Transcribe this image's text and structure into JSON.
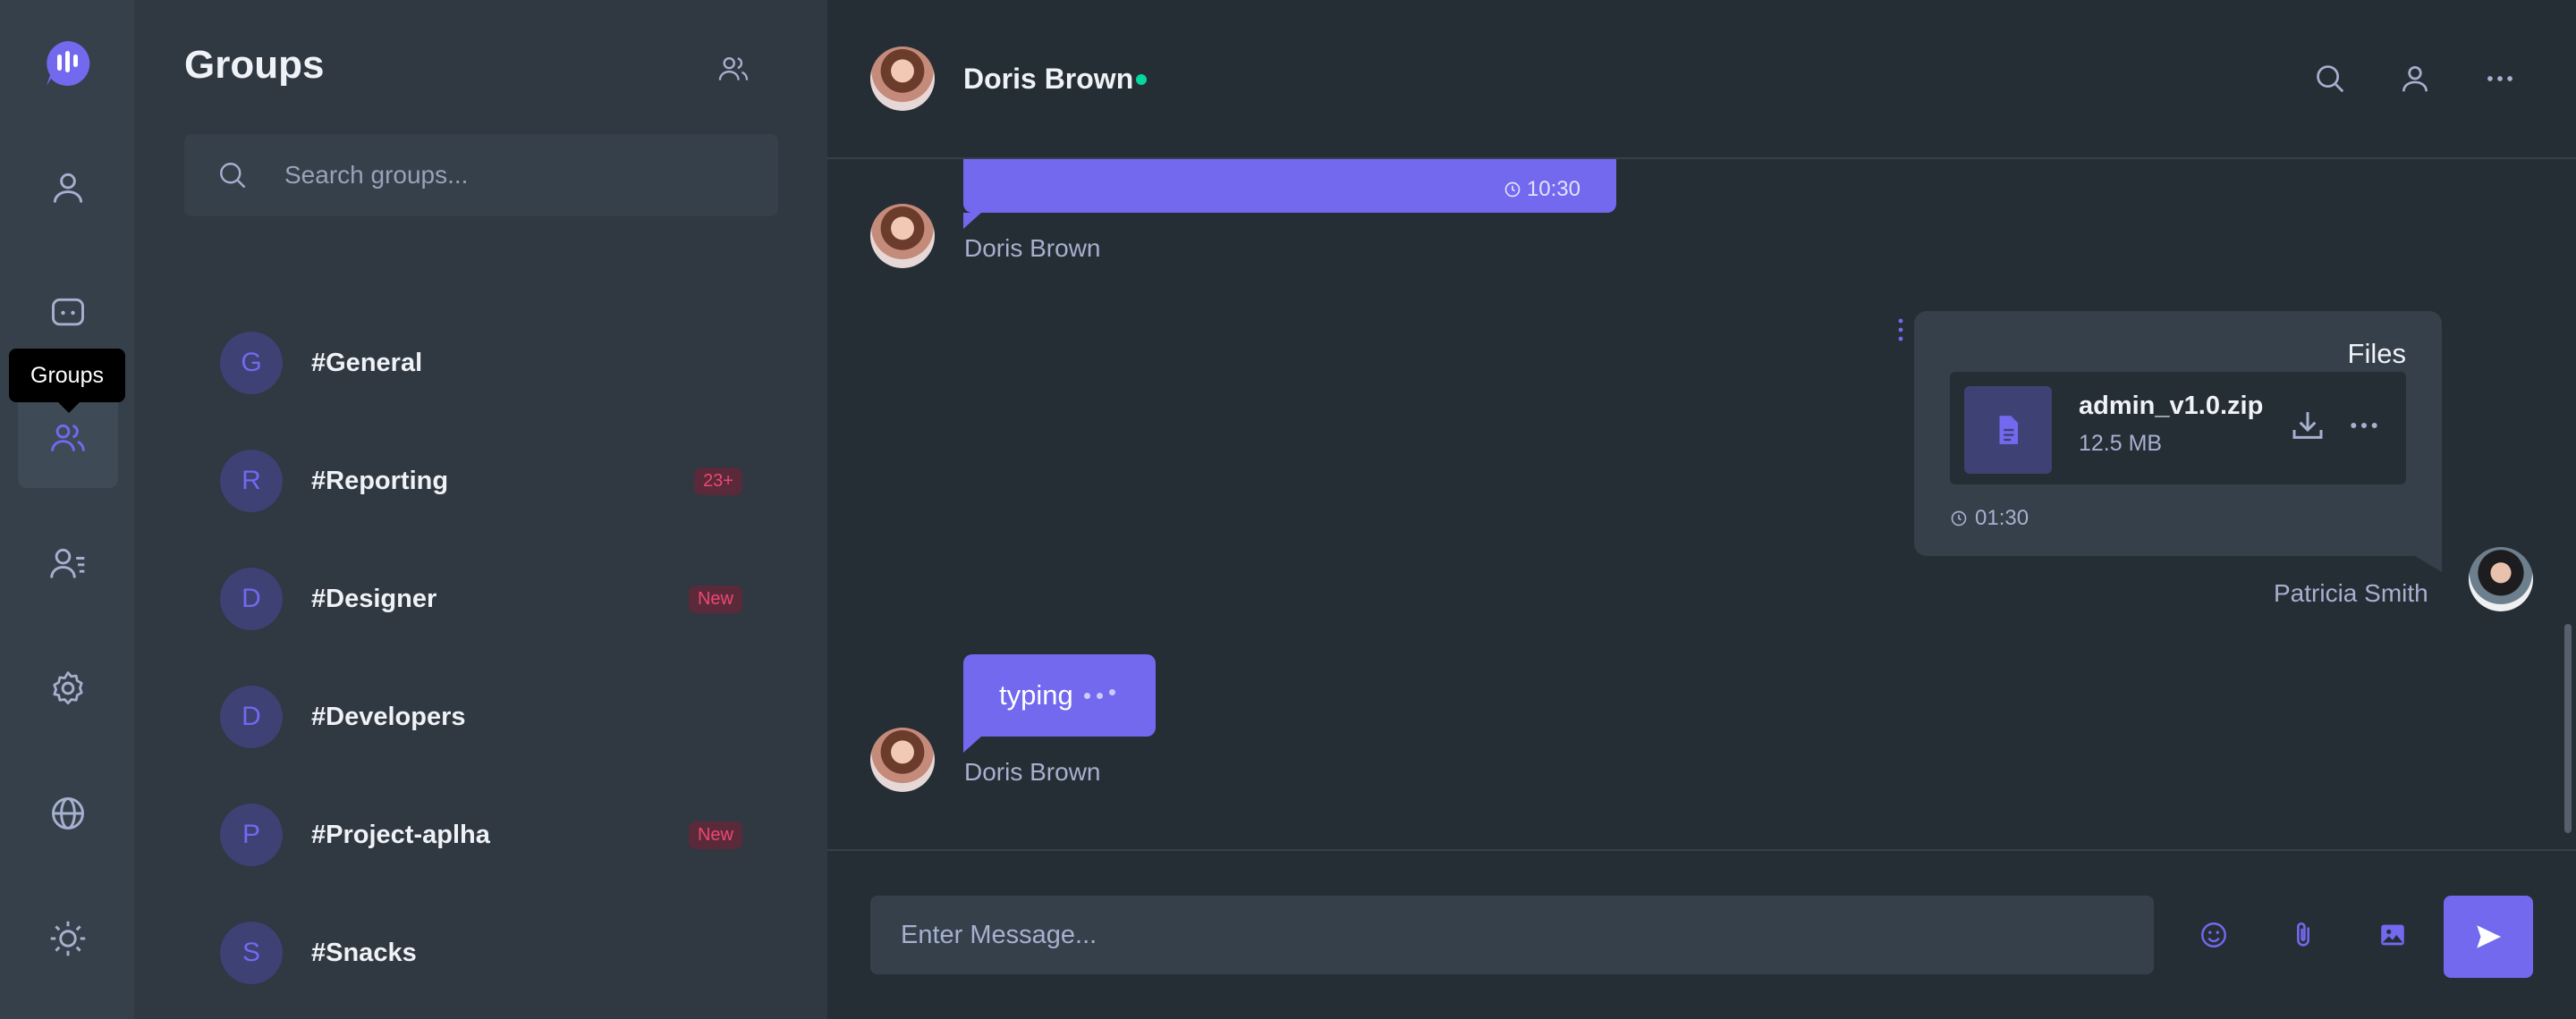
{
  "tooltip": "Groups",
  "groups_panel": {
    "title": "Groups",
    "search_placeholder": "Search groups...",
    "groups": [
      {
        "initial": "G",
        "name": "#General",
        "badge": ""
      },
      {
        "initial": "R",
        "name": "#Reporting",
        "badge": "23+"
      },
      {
        "initial": "D",
        "name": "#Designer",
        "badge": "New"
      },
      {
        "initial": "D",
        "name": "#Developers",
        "badge": ""
      },
      {
        "initial": "P",
        "name": "#Project-aplha",
        "badge": "New"
      },
      {
        "initial": "S",
        "name": "#Snacks",
        "badge": ""
      }
    ]
  },
  "chat": {
    "contact_name": "Doris Brown",
    "messages": {
      "first_time": "10:30",
      "first_sender": "Doris Brown",
      "file_label": "Files",
      "file_name": "admin_v1.0.zip",
      "file_size": "12.5 MB",
      "file_time": "01:30",
      "file_sender": "Patricia Smith",
      "typing_text": "typing",
      "typing_sender": "Doris Brown"
    },
    "input_placeholder": "Enter Message..."
  },
  "colors": {
    "accent": "#7269ef",
    "online": "#06d6a0",
    "badge": "#ef476f"
  }
}
